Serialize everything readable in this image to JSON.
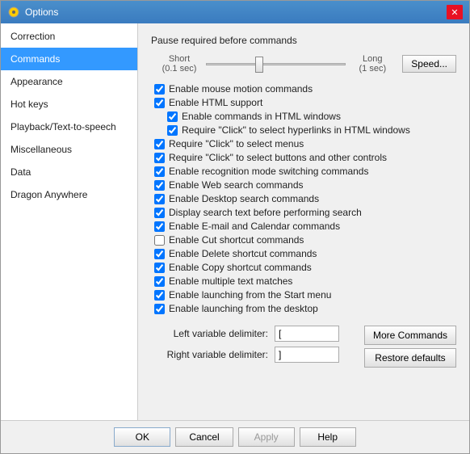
{
  "window": {
    "title": "Options",
    "close_label": "✕"
  },
  "sidebar": {
    "items": [
      {
        "label": "Correction",
        "id": "correction",
        "active": false
      },
      {
        "label": "Commands",
        "id": "commands",
        "active": true
      },
      {
        "label": "Appearance",
        "id": "appearance",
        "active": false
      },
      {
        "label": "Hot keys",
        "id": "hotkeys",
        "active": false
      },
      {
        "label": "Playback/Text-to-speech",
        "id": "playback",
        "active": false
      },
      {
        "label": "Miscellaneous",
        "id": "misc",
        "active": false
      },
      {
        "label": "Data",
        "id": "data",
        "active": false
      },
      {
        "label": "Dragon Anywhere",
        "id": "dragon",
        "active": false
      }
    ]
  },
  "main": {
    "slider_section_title": "Pause required before commands",
    "slider_short_label": "Short",
    "slider_short_value": "(0.1 sec)",
    "slider_long_label": "Long",
    "slider_long_value": "(1 sec)",
    "speed_button": "Speed...",
    "checkboxes": [
      {
        "id": "mouse_motion",
        "label": "Enable mouse motion commands",
        "checked": true,
        "indent": 0
      },
      {
        "id": "html_support",
        "label": "Enable HTML support",
        "checked": true,
        "indent": 0
      },
      {
        "id": "html_commands",
        "label": "Enable commands in HTML windows",
        "checked": true,
        "indent": 1
      },
      {
        "id": "html_hyperlinks",
        "label": "Require \"Click\" to select hyperlinks in HTML windows",
        "checked": true,
        "indent": 1
      },
      {
        "id": "click_menus",
        "label": "Require \"Click\" to select menus",
        "checked": true,
        "indent": 0
      },
      {
        "id": "click_buttons",
        "label": "Require \"Click\" to select buttons and other controls",
        "checked": true,
        "indent": 0
      },
      {
        "id": "recognition_mode",
        "label": "Enable recognition mode switching commands",
        "checked": true,
        "indent": 0
      },
      {
        "id": "web_search",
        "label": "Enable Web search commands",
        "checked": true,
        "indent": 0
      },
      {
        "id": "desktop_search",
        "label": "Enable Desktop search commands",
        "checked": true,
        "indent": 0
      },
      {
        "id": "display_search",
        "label": "Display search text before performing search",
        "checked": true,
        "indent": 0
      },
      {
        "id": "email_calendar",
        "label": "Enable E-mail and Calendar commands",
        "checked": true,
        "indent": 0
      },
      {
        "id": "cut_shortcut",
        "label": "Enable Cut shortcut commands",
        "checked": false,
        "indent": 0
      },
      {
        "id": "delete_shortcut",
        "label": "Enable Delete shortcut commands",
        "checked": true,
        "indent": 0
      },
      {
        "id": "copy_shortcut",
        "label": "Enable Copy shortcut commands",
        "checked": true,
        "indent": 0
      },
      {
        "id": "multiple_text",
        "label": "Enable multiple text matches",
        "checked": true,
        "indent": 0
      },
      {
        "id": "start_menu",
        "label": "Enable launching from the Start menu",
        "checked": true,
        "indent": 0
      },
      {
        "id": "desktop",
        "label": "Enable launching from the desktop",
        "checked": true,
        "indent": 0
      }
    ],
    "left_delimiter_label": "Left variable delimiter:",
    "left_delimiter_value": "[",
    "right_delimiter_label": "Right variable delimiter:",
    "right_delimiter_value": "]",
    "more_commands_btn": "More Commands",
    "restore_defaults_btn": "Restore defaults"
  },
  "footer": {
    "ok": "OK",
    "cancel": "Cancel",
    "apply": "Apply",
    "help": "Help"
  }
}
